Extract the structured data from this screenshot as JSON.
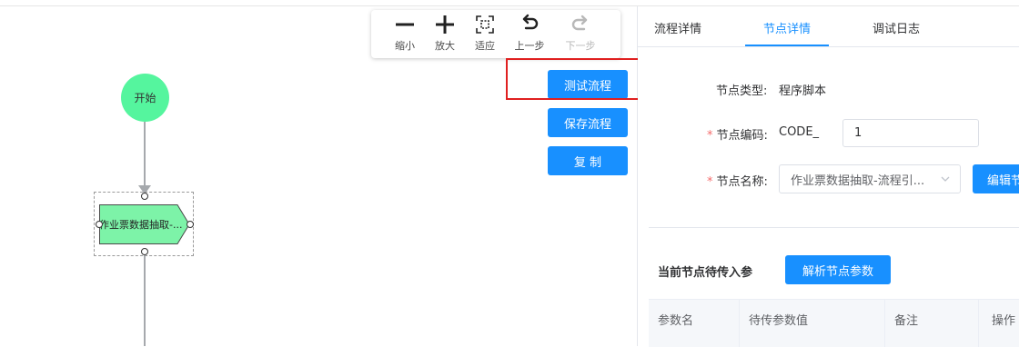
{
  "toolbar": {
    "zoom_out": {
      "label": "缩小",
      "icon": "minus-icon"
    },
    "zoom_in": {
      "label": "放大",
      "icon": "plus-icon"
    },
    "fit": {
      "label": "适应",
      "icon": "fit-screen-icon"
    },
    "undo": {
      "label": "上一步",
      "icon": "undo-icon"
    },
    "redo": {
      "label": "下一步",
      "icon": "redo-icon",
      "disabled": true
    }
  },
  "actions": {
    "test_flow": "测试流程",
    "save_flow": "保存流程",
    "copy": "复 制"
  },
  "flow": {
    "start_node": "开始",
    "task_node": "作业票数据抽取-..."
  },
  "panel": {
    "tabs": [
      {
        "label": "流程详情"
      },
      {
        "label": "节点详情",
        "active": true
      },
      {
        "label": "调试日志"
      }
    ],
    "node_type": {
      "label": "节点类型:",
      "value": "程序脚本"
    },
    "node_code": {
      "required_mark": "*",
      "label": "节点编码:",
      "prefix": "CODE_",
      "value": "1"
    },
    "node_name": {
      "required_mark": "*",
      "label": "节点名称:",
      "value": "作业票数据抽取-流程引...",
      "edit_button": "编辑节"
    },
    "params_section": {
      "title": "当前节点待传入参",
      "parse_button": "解析节点参数",
      "columns": [
        "参数名",
        "待传参数值",
        "备注",
        "操作"
      ]
    }
  },
  "colors": {
    "accent": "#1890ff",
    "start_node": "#55f59e",
    "task_node": "#7df3a8",
    "highlight": "#e02020",
    "required": "#f56c6c"
  }
}
